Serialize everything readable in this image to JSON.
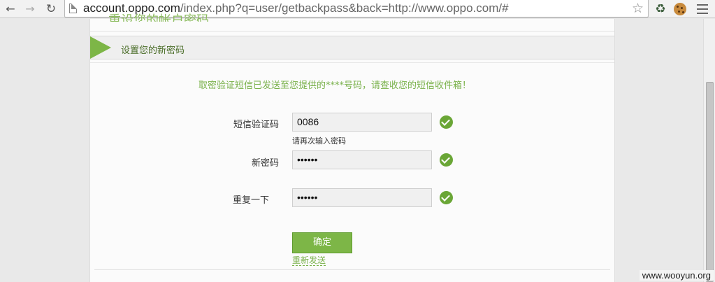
{
  "browser": {
    "url_host": "account.oppo.com",
    "url_path": "/index.php?q=user/getbackpass&back=http://www.oppo.com/#"
  },
  "page": {
    "top_title": "重设您的帐户密码",
    "step_title": "设置您的新密码",
    "notice": "取密验证短信已发送至您提供的****号码，请查收您的短信收件箱！",
    "form": {
      "code_label": "短信验证码",
      "code_value": "0086",
      "code_hint": "请再次输入密码",
      "new_password_label": "新密码",
      "new_password_value": "••••••",
      "repeat_label": "重复一下",
      "repeat_value": "••••••"
    },
    "confirm_label": "确定",
    "resend_label": "重新发送"
  },
  "watermark": "www.wooyun.org",
  "colors": {
    "accent": "#7db647",
    "text_green": "#79b14a",
    "check": "#6aa636"
  }
}
